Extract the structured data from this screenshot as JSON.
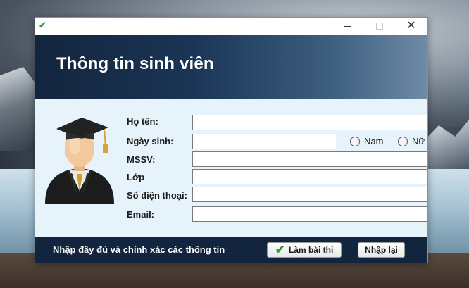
{
  "window": {
    "title": "",
    "app_icon": "check-icon",
    "controls": {
      "minimize": "minimize-icon",
      "maximize": "maximize-icon",
      "close": "close-icon"
    }
  },
  "header": {
    "title": "Thông tin sinh viên"
  },
  "form": {
    "avatar_icon": "graduate-avatar-icon",
    "fields": [
      {
        "label": "Họ tên:",
        "value": ""
      },
      {
        "label": "Ngày sinh:",
        "value": ""
      },
      {
        "label": "MSSV:",
        "value": ""
      },
      {
        "label": "Lớp",
        "value": ""
      },
      {
        "label": "Số điện thoại:",
        "value": ""
      },
      {
        "label": "Email:",
        "value": ""
      }
    ],
    "gender": {
      "options": [
        "Nam",
        "Nữ"
      ],
      "selected": null
    }
  },
  "footer": {
    "note": "Nhập đầy đủ và chính xác các thông tin",
    "submit_label": "Làm bài thi",
    "reset_label": "Nhập lại"
  },
  "colors": {
    "header_dark": "#13253e",
    "header_light": "#6f8ba6",
    "form_background": "#e6f3fb",
    "accent_green": "#2e9a34"
  }
}
